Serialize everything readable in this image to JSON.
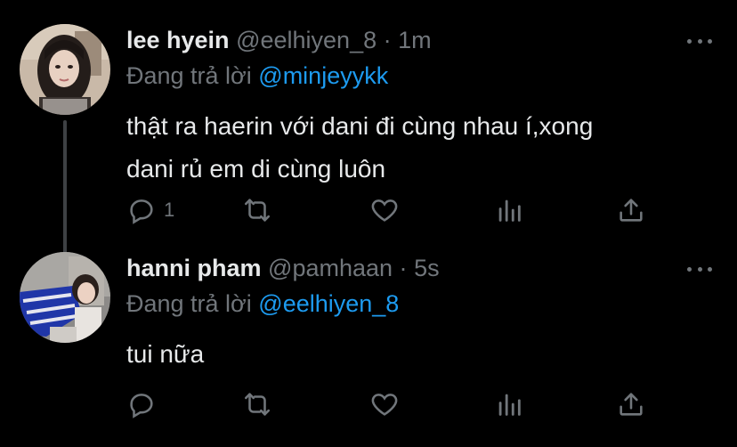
{
  "tweets": [
    {
      "name": "lee hyein",
      "handle": "@eelhiyen_8",
      "separator": "·",
      "time": "1m",
      "reply_prefix": "Đang trả lời",
      "reply_to": "@minjeyykk",
      "text_line1": "thật ra haerin với dani đi cùng nhau í,xong",
      "text_line2": "dani rủ em di cùng luôn",
      "reply_count": "1"
    },
    {
      "name": "hanni pham",
      "handle": "@pamhaan",
      "separator": "·",
      "time": "5s",
      "reply_prefix": "Đang trả lời",
      "reply_to": "@eelhiyen_8",
      "text_line1": "tui nữa",
      "reply_count": ""
    }
  ],
  "icons": {
    "reply": "reply-icon",
    "retweet": "retweet-icon",
    "like": "heart-icon",
    "stats": "stats-icon",
    "share": "share-icon",
    "more": "more-icon"
  },
  "colors": {
    "background": "#000000",
    "text": "#e7e9ea",
    "secondary": "#71767b",
    "mention": "#1d9bf0"
  }
}
